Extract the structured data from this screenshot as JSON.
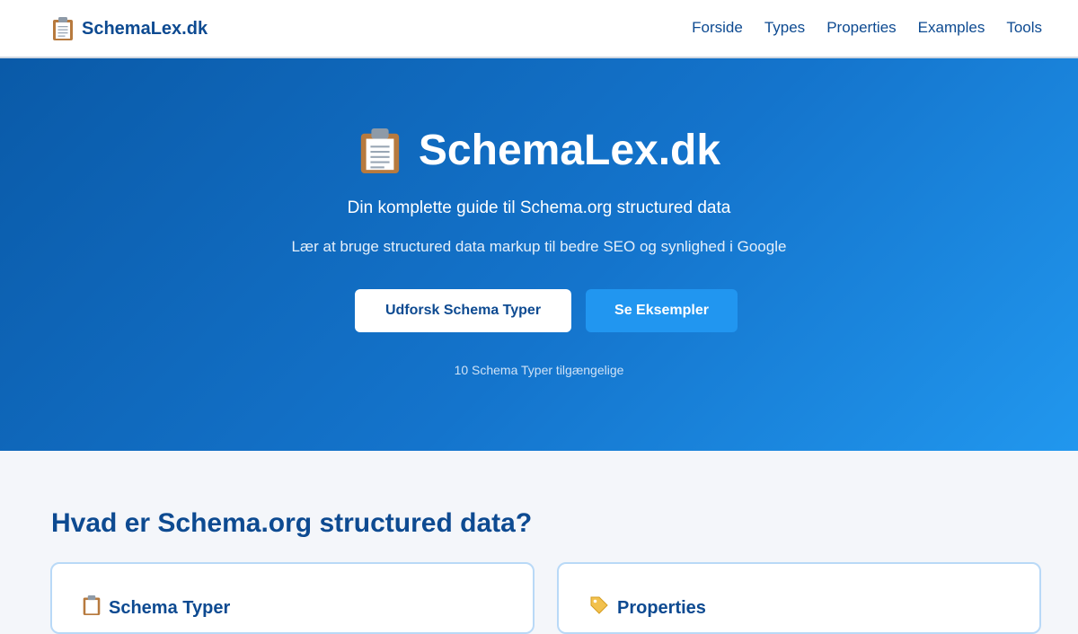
{
  "header": {
    "brand": "SchemaLex.dk",
    "brand_icon": "clipboard-icon",
    "nav": [
      {
        "label": "Forside"
      },
      {
        "label": "Types"
      },
      {
        "label": "Properties"
      },
      {
        "label": "Examples"
      },
      {
        "label": "Tools"
      }
    ]
  },
  "hero": {
    "title": "SchemaLex.dk",
    "subtitle": "Din komplette guide til Schema.org structured data",
    "tagline": "Lær at bruge structured data markup til bedre SEO og synlighed i Google",
    "primary_button": "Udforsk Schema Typer",
    "secondary_button": "Se Eksempler",
    "count_text": "10 Schema Typer tilgængelige"
  },
  "main": {
    "section_title": "Hvad er Schema.org structured data?",
    "cards": [
      {
        "title": "Schema Typer",
        "icon": "clipboard-icon"
      },
      {
        "title": "Properties",
        "icon": "tag-icon"
      }
    ]
  },
  "colors": {
    "brand": "#0d4a91",
    "hero_start": "#0a5aa8",
    "hero_end": "#2197ee",
    "accent_button": "#2196f0"
  }
}
